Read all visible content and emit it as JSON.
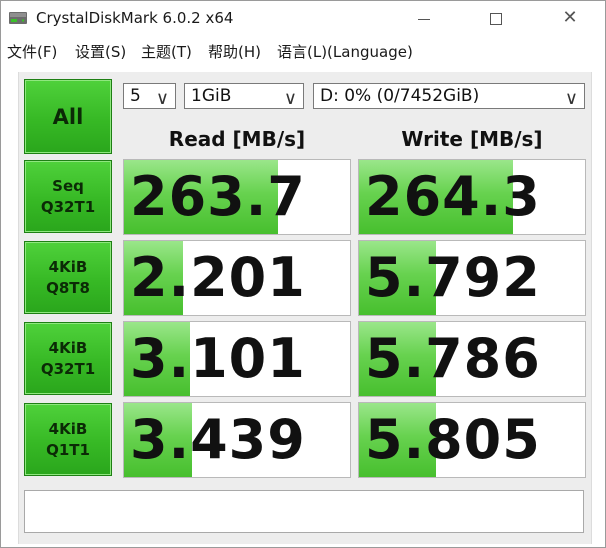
{
  "window": {
    "title": "CrystalDiskMark 6.0.2 x64"
  },
  "menu": [
    "文件(F)",
    "设置(S)",
    "主题(T)",
    "帮助(H)",
    "语言(L)(Language)"
  ],
  "controls": {
    "all_label": "All",
    "count": "5",
    "size": "1GiB",
    "drive": "D: 0% (0/7452GiB)"
  },
  "columns": {
    "read": "Read [MB/s]",
    "write": "Write [MB/s]"
  },
  "tests": [
    {
      "line1": "Seq",
      "line2": "Q32T1",
      "read": "263.7",
      "write": "264.3",
      "read_fill": 0.68,
      "write_fill": 0.68
    },
    {
      "line1": "4KiB",
      "line2": "Q8T8",
      "read": "2.201",
      "write": "5.792",
      "read_fill": 0.26,
      "write_fill": 0.34
    },
    {
      "line1": "4KiB",
      "line2": "Q32T1",
      "read": "3.101",
      "write": "5.786",
      "read_fill": 0.29,
      "write_fill": 0.34
    },
    {
      "line1": "4KiB",
      "line2": "Q1T1",
      "read": "3.439",
      "write": "5.805",
      "read_fill": 0.3,
      "write_fill": 0.34
    }
  ],
  "status_text": "",
  "colors": {
    "green": "#37b925",
    "bar": "#67d24f"
  }
}
